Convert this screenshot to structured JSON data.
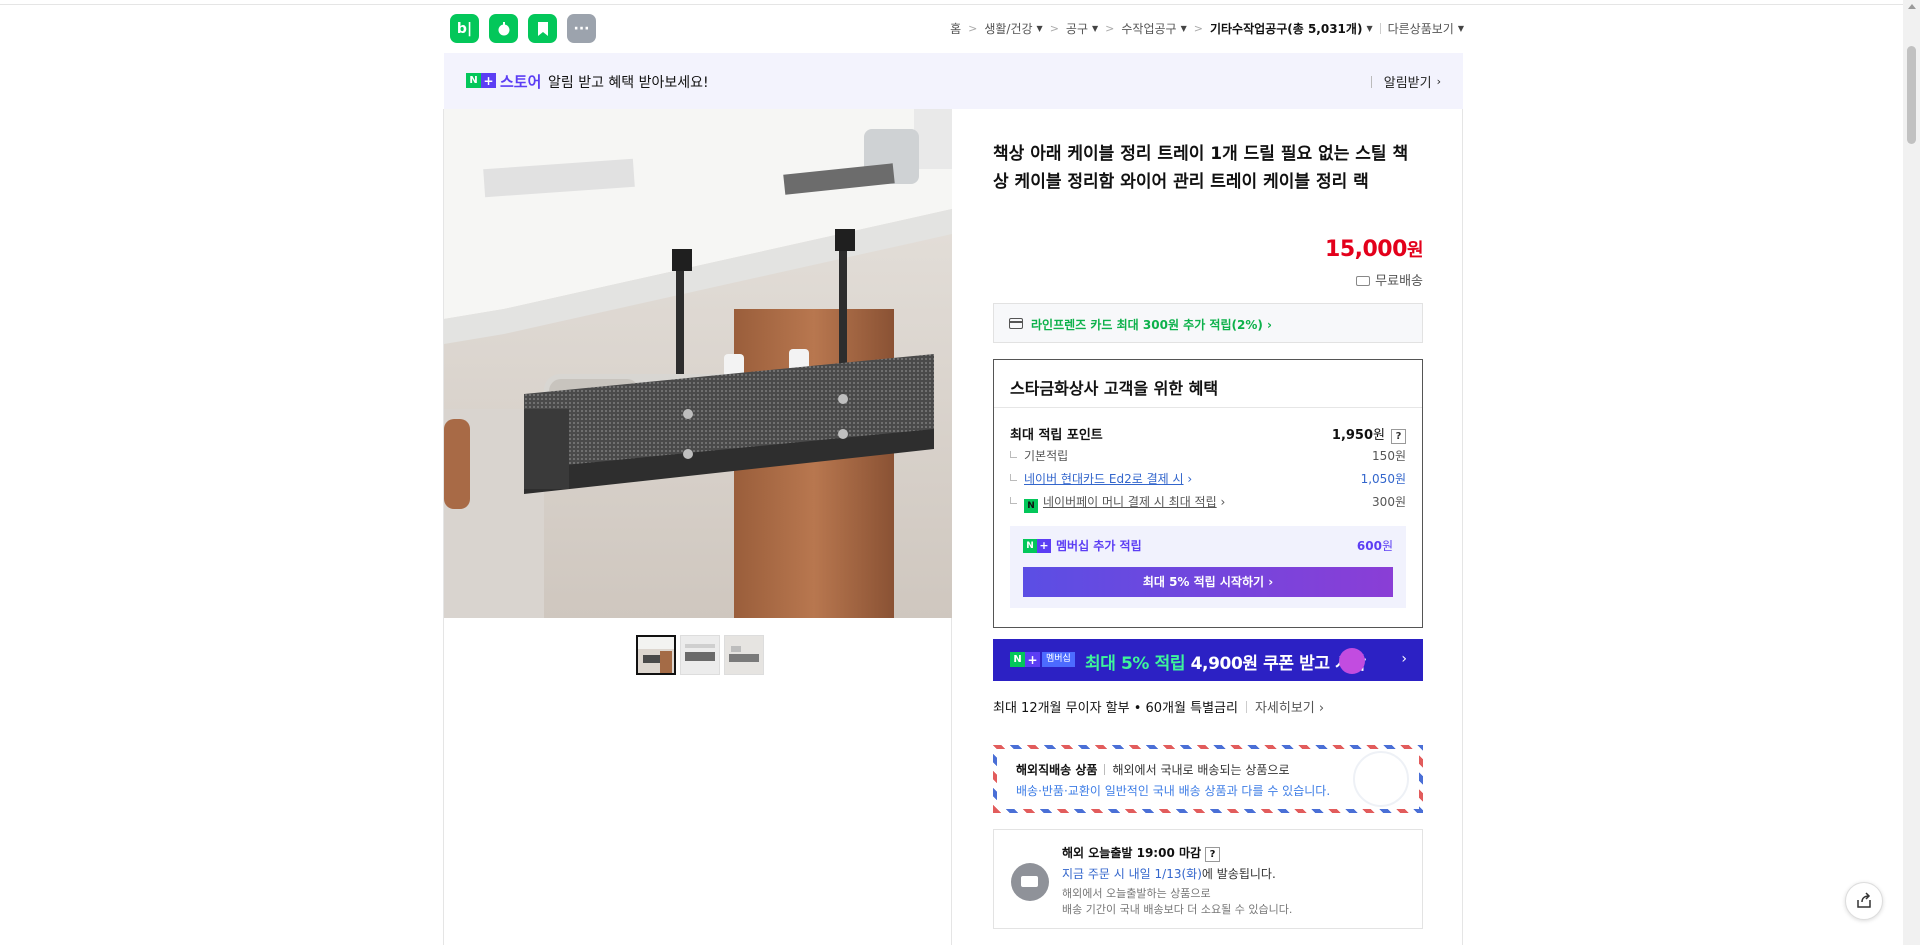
{
  "header": {
    "app_icons": [
      {
        "name": "blog-app-icon",
        "label": "b|",
        "color": "#03c75a"
      },
      {
        "name": "cafe-app-icon",
        "label": "",
        "color": "#03c75a"
      },
      {
        "name": "bookmark-app-icon",
        "label": "",
        "color": "#03c75a"
      },
      {
        "name": "more-apps-icon",
        "label": "···",
        "color": "#9ca3ad"
      }
    ],
    "breadcrumb": {
      "home": "홈",
      "items": [
        "생활/건강",
        "공구",
        "수작업공구"
      ],
      "current": "기타수작업공구(총 5,031개)",
      "other": "다른상품보기"
    }
  },
  "store_banner": {
    "n_label": "N",
    "plus_label": "+",
    "store_word": "스토어",
    "message": "알림 받고 혜택 받아보세요!",
    "notify_label": "알림받기"
  },
  "product": {
    "title": "책상 아래 케이블 정리 트레이 1개 드릴 필요 없는 스틸 책상 케이블 정리함 와이어 관리 트레이 케이블 정리 랙",
    "price": "15,000",
    "price_unit": "원",
    "shipping": "무료배송",
    "thumbnail_count": 3,
    "active_thumbnail": 0
  },
  "card_promo": {
    "text": "라인프렌즈 카드 최대 300원 추가 적립(2%)",
    "chevron": "›"
  },
  "benefit": {
    "heading": "스타금화상사 고객을 위한 혜택",
    "max_points_label": "최대 적립 포인트",
    "max_points_value": "1,950",
    "unit": "원",
    "question_mark": "?",
    "rows": [
      {
        "label": "기본적립",
        "value": "150원"
      },
      {
        "label": "네이버 현대카드 Ed2로 결제 시",
        "value": "1,050원"
      },
      {
        "label": "네이버페이 머니 결제 시 최대 적립",
        "value": "300원"
      }
    ],
    "npay_mark": "N",
    "membership": {
      "label": "멤버십 추가 적립",
      "value": "600",
      "unit": "원",
      "button_label": "최대 5% 적립 시작하기 ›"
    }
  },
  "promo_banner": {
    "chip": "멤버십",
    "text_highlight": "최대 5% 적립",
    "text_rest": "4,900원 쿠폰 받고 시작",
    "chevron": "›",
    "colors": {
      "background": "#2c21c4",
      "highlight": "#3ef59a"
    }
  },
  "installment": {
    "text": "최대 12개월 무이자 할부 • 60개월 특별금리",
    "more": "자세히보기 ›"
  },
  "overseas": {
    "title": "해외직배송 상품",
    "line1": "해외에서 국내로 배송되는 상품으로",
    "line2": "배송·반품·교환이 일반적인 국내 배송 상품과 다를 수 있습니다."
  },
  "dispatch": {
    "title": "해외 오늘출발 19:00 마감",
    "question_mark": "?",
    "order_prefix": "지금 주문 시 내일 1/13(화)",
    "order_suffix": "에 발송됩니다.",
    "note1": "해외에서 오늘출발하는 상품으로",
    "note2": "배송 기간이 국내 배송보다 더 소요될 수 있습니다."
  },
  "colors": {
    "naver_green": "#03c75a",
    "accent_purple": "#5c3ef4",
    "price_red": "#e3001b"
  }
}
